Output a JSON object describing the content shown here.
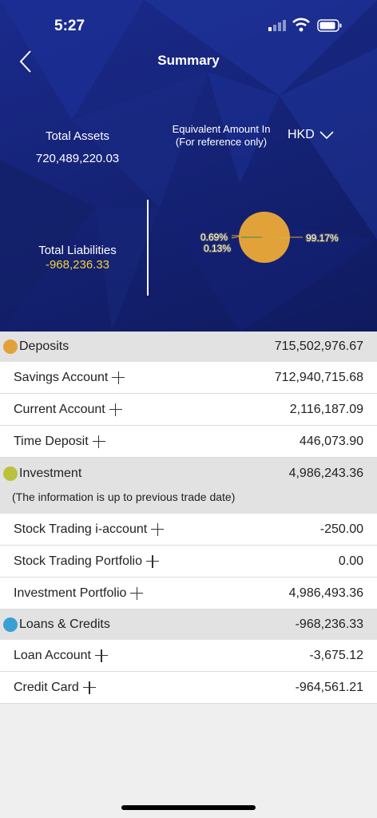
{
  "status": {
    "time": "5:27"
  },
  "header": {
    "title": "Summary"
  },
  "summary": {
    "total_assets_label": "Total Assets",
    "total_assets_value": "720,489,220.03",
    "equiv_label_line1": "Equivalent Amount In",
    "equiv_label_line2": "(For reference only)",
    "currency": "HKD",
    "total_liabilities_label": "Total Liabilities",
    "total_liabilities_value": "-968,236.33"
  },
  "pie": {
    "labels": [
      "0.69%",
      "0.13%",
      "99.17%"
    ],
    "slices": [
      {
        "name": "Deposits",
        "percent": 99.17,
        "color": "#e2a23a"
      },
      {
        "name": "Investment",
        "percent": 0.69,
        "color": "#b9c23a"
      },
      {
        "name": "Loans & Credits",
        "percent": 0.13,
        "color": "#3aa0d4"
      }
    ]
  },
  "colors": {
    "deposits": "#e2a23a",
    "investment": "#b9c23a",
    "loans": "#3aa0d4",
    "liability_text": "#f5d33a"
  },
  "groups": {
    "deposits": {
      "name": "Deposits",
      "total": "715,502,976.67",
      "rows": [
        {
          "name": "Savings Account",
          "amount": "712,940,715.68"
        },
        {
          "name": "Current Account",
          "amount": "2,116,187.09"
        },
        {
          "name": "Time Deposit",
          "amount": "446,073.90"
        }
      ]
    },
    "investment": {
      "name": "Investment",
      "total": "4,986,243.36",
      "note": "(The information is up to previous trade date)",
      "rows": [
        {
          "name": "Stock Trading i-account",
          "amount": "-250.00"
        },
        {
          "name": "Stock Trading Portfolio",
          "amount": "0.00"
        },
        {
          "name": "Investment Portfolio",
          "amount": "4,986,493.36"
        }
      ]
    },
    "loans": {
      "name": "Loans & Credits",
      "total": "-968,236.33",
      "rows": [
        {
          "name": "Loan Account",
          "amount": "-3,675.12"
        },
        {
          "name": "Credit Card",
          "amount": "-964,561.21"
        }
      ]
    }
  }
}
